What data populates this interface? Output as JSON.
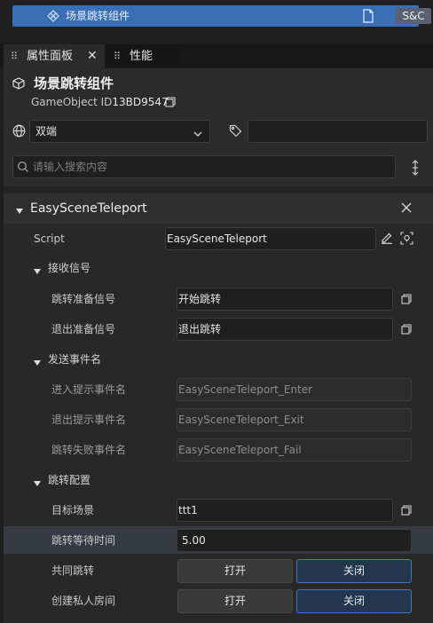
{
  "scene_tree": {
    "selected_item_label": "场景跳转组件",
    "badge": "S&C"
  },
  "tabs": [
    {
      "label": "属性面板",
      "active": true
    },
    {
      "label": "性能",
      "active": false
    }
  ],
  "component": {
    "title": "场景跳转组件",
    "gameobject_id_label": "GameObject ID",
    "gameobject_id": "13BD9547"
  },
  "platform_dropdown": {
    "selected": "双端"
  },
  "tag_input": {
    "value": ""
  },
  "search": {
    "placeholder": "请输入搜索内容"
  },
  "script_component": {
    "title": "EasySceneTeleport",
    "script_label": "Script",
    "script_value": "EasySceneTeleport"
  },
  "sections": {
    "receive": {
      "label": "接收信号",
      "ready_signal_label": "跳转准备信号",
      "ready_signal_value": "开始跳转",
      "exit_signal_label": "退出准备信号",
      "exit_signal_value": "退出跳转"
    },
    "send": {
      "label": "发送事件名",
      "enter_event_label": "进入提示事件名",
      "enter_event_value": "EasySceneTeleport_Enter",
      "exit_event_label": "退出提示事件名",
      "exit_event_value": "EasySceneTeleport_Exit",
      "fail_event_label": "跳转失败事件名",
      "fail_event_value": "EasySceneTeleport_Fail"
    },
    "config": {
      "label": "跳转配置",
      "target_scene_label": "目标场景",
      "target_scene_value": "ttt1",
      "wait_time_label": "跳转等待时间",
      "wait_time_value": "5.00",
      "shared_teleport_label": "共同跳转",
      "private_room_label": "创建私人房间",
      "on_label": "打开",
      "off_label": "关闭",
      "shared_teleport_state": "关闭",
      "private_room_state": "关闭"
    }
  },
  "colors": {
    "selection": "#3a6fb5",
    "toggle_active_border": "#3f78c0",
    "panel_bg": "#2b2b2b"
  }
}
